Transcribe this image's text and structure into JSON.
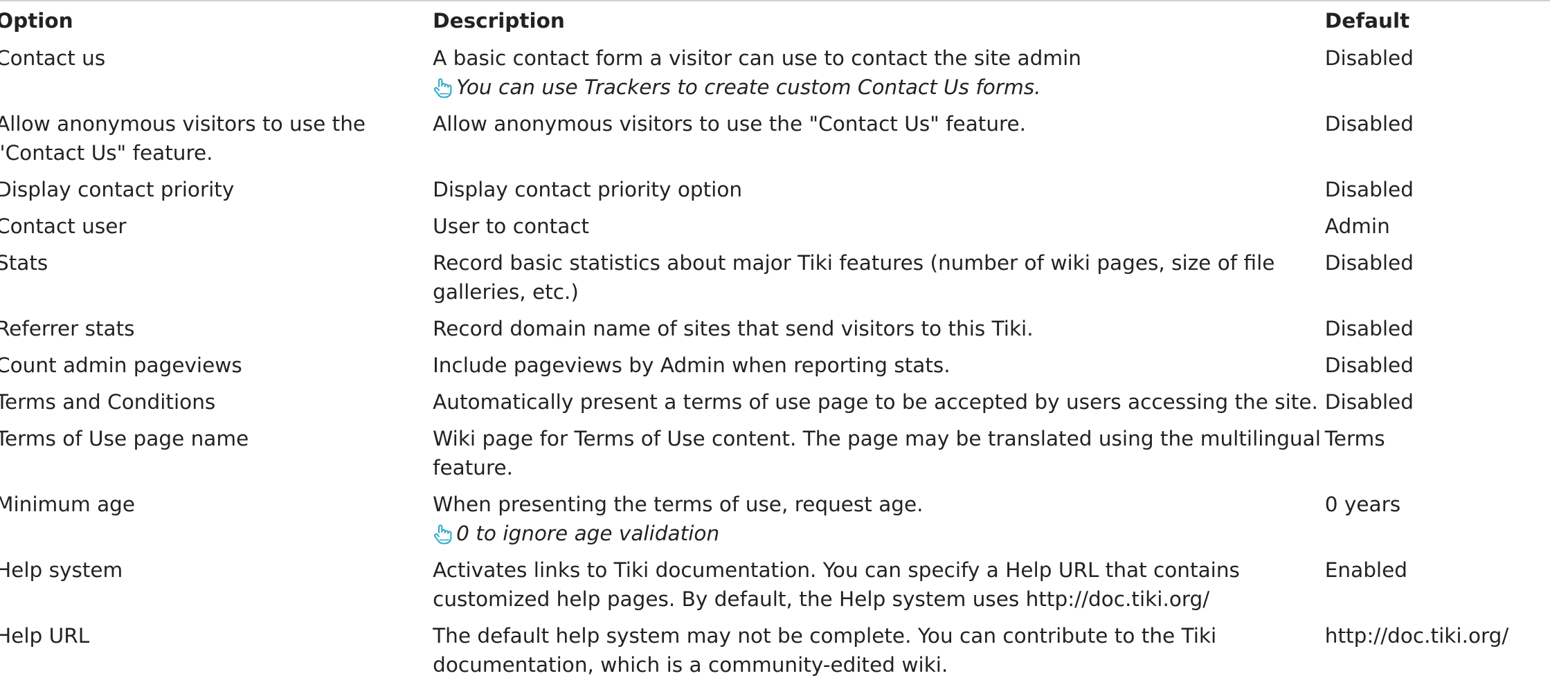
{
  "table": {
    "headers": {
      "option": "Option",
      "description": "Description",
      "default": "Default"
    },
    "rows": [
      {
        "option": "Contact us",
        "description": "A basic contact form a visitor can use to contact the site admin",
        "hint": "You can use Trackers to create custom Contact Us forms.",
        "default": "Disabled"
      },
      {
        "option": "Allow anonymous visitors to use the \"Contact Us\" feature.",
        "description": "Allow anonymous visitors to use the \"Contact Us\" feature.",
        "hint": "",
        "default": "Disabled"
      },
      {
        "option": "Display contact priority",
        "description": "Display contact priority option",
        "hint": "",
        "default": "Disabled"
      },
      {
        "option": "Contact user",
        "description": "User to contact",
        "hint": "",
        "default": "Admin"
      },
      {
        "option": "Stats",
        "description": "Record basic statistics about major Tiki features (number of wiki pages, size of file galleries, etc.)",
        "hint": "",
        "default": "Disabled"
      },
      {
        "option": "Referrer stats",
        "description": "Record domain name of sites that send visitors to this Tiki.",
        "hint": "",
        "default": "Disabled"
      },
      {
        "option": "Count admin pageviews",
        "description": "Include pageviews by Admin when reporting stats.",
        "hint": "",
        "default": "Disabled"
      },
      {
        "option": "Terms and Conditions",
        "description": "Automatically present a terms of use page to be accepted by users accessing the site.",
        "hint": "",
        "default": "Disabled"
      },
      {
        "option": "Terms of Use page name",
        "description": "Wiki page for Terms of Use content. The page may be translated using the multilingual feature.",
        "hint": "",
        "default": "Terms"
      },
      {
        "option": "Minimum age",
        "description": "When presenting the terms of use, request age.",
        "hint": "0 to ignore age validation",
        "default": "0 years"
      },
      {
        "option": "Help system",
        "description": "Activates links to Tiki documentation. You can specify a Help URL that contains customized help pages. By default, the Help system uses http://doc.tiki.org/",
        "hint": "",
        "default": "Enabled"
      },
      {
        "option": "Help URL",
        "description": "The default help system may not be complete. You can contribute to the Tiki documentation, which is a community-edited wiki.",
        "hint": "",
        "default": "http://doc.tiki.org/"
      }
    ]
  },
  "hint_icon": "pointing-hand-icon",
  "colors": {
    "hint_icon": "#2aa8c8",
    "text": "#222222"
  }
}
